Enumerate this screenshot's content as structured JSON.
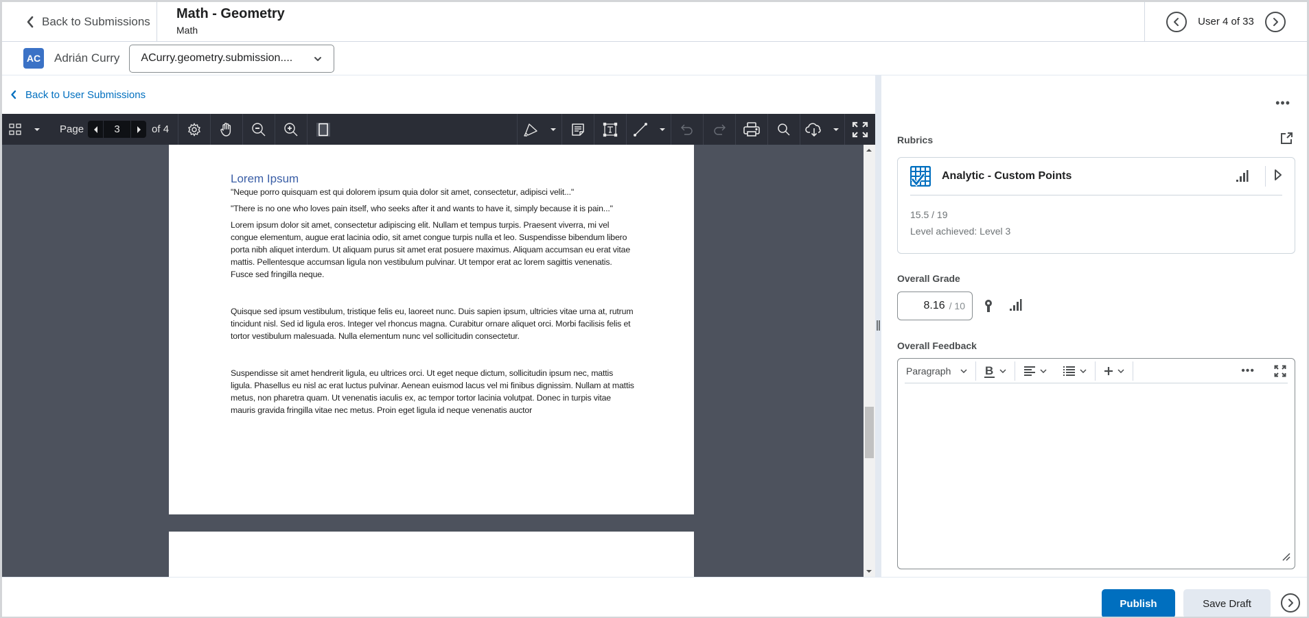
{
  "header": {
    "back_label": "Back to Submissions",
    "title": "Math - Geometry",
    "subtitle": "Math",
    "user_position": "User 4 of 33"
  },
  "user": {
    "initials": "AC",
    "name": "Adrián Curry",
    "file_selected": "ACurry.geometry.submission...."
  },
  "back_user_label": "Back to User Submissions",
  "pdf_toolbar": {
    "page_label": "Page",
    "current_page": "3",
    "of_label": "of 4",
    "icons": [
      "thumbnails-icon",
      "dropdown-caret-icon",
      "settings-icon",
      "pan-hand-icon",
      "zoom-out-icon",
      "zoom-in-icon",
      "page-view-icon",
      "highlighter-icon",
      "note-icon",
      "text-box-icon",
      "line-icon",
      "undo-icon",
      "redo-icon",
      "print-icon",
      "search-icon",
      "download-icon",
      "fullscreen-icon"
    ]
  },
  "document": {
    "heading": "Lorem Ipsum",
    "paragraphs": [
      "\"Neque porro quisquam est qui dolorem ipsum quia dolor sit amet, consectetur, adipisci velit...\"",
      "\"There is no one who loves pain itself, who seeks after it and wants to have it, simply because it is pain...\"",
      "Lorem ipsum dolor sit amet, consectetur adipiscing elit. Nullam et tempus turpis. Praesent viverra, mi vel congue elementum, augue erat lacinia odio, sit amet congue turpis nulla et leo. Suspendisse bibendum libero porta nibh aliquet interdum. Ut aliquam purus sit amet erat posuere maximus. Aliquam accumsan eu erat vitae mattis. Pellentesque accumsan ligula non vestibulum pulvinar. Ut tempor erat ac lorem sagittis venenatis. Fusce sed fringilla neque.",
      "Quisque sed ipsum vestibulum, tristique felis eu, laoreet nunc. Duis sapien ipsum, ultricies vitae urna at, rutrum tincidunt nisl. Sed id ligula eros. Integer vel rhoncus magna. Curabitur ornare aliquet orci. Morbi facilisis felis et tortor vestibulum malesuada. Nulla elementum nunc vel sollicitudin consectetur.",
      "Suspendisse sit amet hendrerit ligula, eu ultrices orci. Ut eget neque dictum, sollicitudin ipsum nec, mattis ligula. Phasellus eu nisl ac erat luctus pulvinar. Aenean euismod lacus vel mi finibus dignissim. Nullam at mattis metus, non pharetra quam. Ut venenatis iaculis ex, ac tempor tortor lacinia volutpat. Donec in turpis vitae mauris gravida fringilla vitae nec metus. Proin eget ligula id neque venenatis auctor"
    ]
  },
  "panel": {
    "more_label": "•••",
    "rubrics_label": "Rubrics",
    "rubric": {
      "name": "Analytic - Custom Points",
      "score": "15.5 / 19",
      "level": "Level achieved: Level 3"
    },
    "overall_grade_label": "Overall Grade",
    "grade_value": "8.16",
    "grade_denominator": "/ 10",
    "overall_feedback_label": "Overall Feedback",
    "editor": {
      "format_select": "Paragraph",
      "more_label": "•••",
      "content": ""
    }
  },
  "footer": {
    "publish_label": "Publish",
    "save_draft_label": "Save Draft"
  },
  "colors": {
    "primary": "#006fbf",
    "toolbar_bg": "#2a2d36",
    "viewer_bg": "#4d525d",
    "avatar": "#3b72c6",
    "doc_heading": "#3a5ea6"
  }
}
